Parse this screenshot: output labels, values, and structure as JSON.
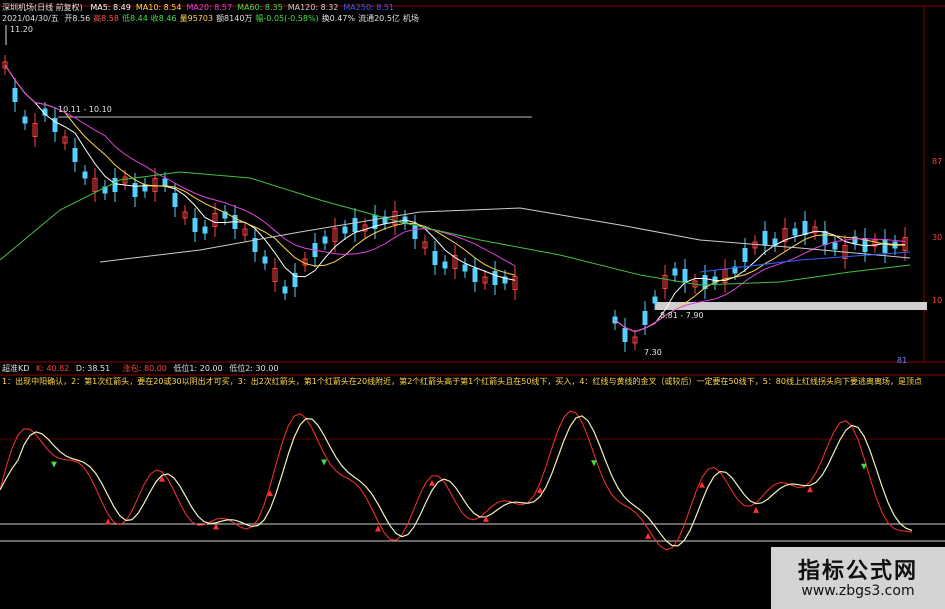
{
  "header": {
    "stock_label": "深圳机场(日线 前复权)",
    "ma_items": [
      {
        "label": "MA5:",
        "value": "8.49",
        "color": "#ffffff"
      },
      {
        "label": "MA10:",
        "value": "8.54",
        "color": "#ffd84a"
      },
      {
        "label": "MA20:",
        "value": "8.57",
        "color": "#e040e0"
      },
      {
        "label": "MA60:",
        "value": "8.35",
        "color": "#40e040"
      },
      {
        "label": "MA120:",
        "value": "8.32",
        "color": "#cccccc"
      },
      {
        "label": "MA250:",
        "value": "8.51",
        "color": "#3060ff"
      }
    ],
    "date": "2021/04/30/五",
    "quote_items": [
      {
        "text": "开8.56",
        "color": "#e0e0e0"
      },
      {
        "text": "高8.58",
        "color": "#ff5050"
      },
      {
        "text": "低8.44",
        "color": "#40e040"
      },
      {
        "text": "收8.46",
        "color": "#40e040"
      },
      {
        "text": "量95703",
        "color": "#ffd84a"
      },
      {
        "text": "额8140万",
        "color": "#e0e0e0"
      },
      {
        "text": "幅-0.05(-0.58%)",
        "color": "#40e040"
      },
      {
        "text": "换0.47%",
        "color": "#e0e0e0"
      },
      {
        "text": "流通20.5亿",
        "color": "#e0e0e0"
      },
      {
        "text": "机场",
        "color": "#e0e0e0"
      }
    ]
  },
  "price_chart": {
    "high_label": "11.20",
    "range_label": "10.11 - 10.10",
    "box_label": "8.81 - 7.90",
    "low_label": "7.30",
    "axis_labels": [
      "87",
      "30",
      "10"
    ],
    "corner_label": "81"
  },
  "indicator": {
    "name": "超准KD",
    "k": "K: 40.82",
    "d": "D: 38.51",
    "signal": "涨包: 80.00",
    "low1": "低位1: 20.00",
    "low2": "低位2: 30.00",
    "description": "1：出现中阳确认，2：第1次红箭头，要在20或30以阴出才可买，3：出2次红箭头，第1个红箭头在20线附近，第2个红箭头高于第1个红箭头且在50线下，买入，4：红线与黄线的金叉（或较后）一定要在50线下，5：80线上红线拐头向下要逃离离场，是顶点。",
    "levels": {
      "upper": 80,
      "low1": 20,
      "low2": 30
    }
  },
  "watermark": {
    "title": "指标公式网",
    "url": "www.zbgs3.com"
  }
}
